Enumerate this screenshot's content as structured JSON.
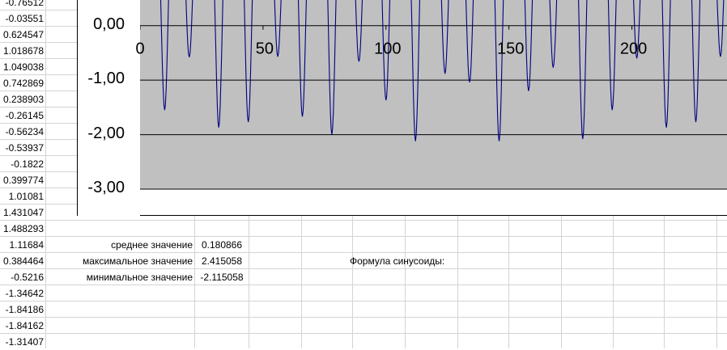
{
  "column_a": [
    "-0.76512",
    "-0.03551",
    "0.624547",
    "1.018678",
    "1.049038",
    "0.742869",
    "0.238903",
    "-0.26145",
    "-0.56234",
    "-0.53937",
    "-0.1822",
    "0.399774",
    "1.01081",
    "1.431047",
    "1.488293",
    "1.11684",
    "0.384464",
    "-0.5216",
    "-1.34642",
    "-1.84186",
    "-1.84162",
    "-1.31407"
  ],
  "stats": {
    "mean_label": "среднее значение",
    "mean_value": "0.180866",
    "max_label": "максимальное значение",
    "max_value": "2.415058",
    "min_label": "минимальное значение",
    "min_value": "-2.115058",
    "formula_label": "Формула синусоиды:"
  },
  "chart_data": {
    "type": "line",
    "x_ticks": [
      "0",
      "50",
      "100",
      "150",
      "200"
    ],
    "y_ticks": [
      "0,00",
      "-1,00",
      "-2,00",
      "-3,00"
    ],
    "y_range": [
      -3,
      0.5
    ],
    "x_range": [
      0,
      239
    ],
    "plot_color": "#C0C0C0",
    "line_color": "#000080",
    "minima": [
      {
        "x": 10,
        "y": -1.55
      },
      {
        "x": 20,
        "y": -0.58
      },
      {
        "x": 32,
        "y": -1.87
      },
      {
        "x": 44,
        "y": -1.77
      },
      {
        "x": 56,
        "y": -0.57
      },
      {
        "x": 66,
        "y": -1.67
      },
      {
        "x": 78,
        "y": -2.0
      },
      {
        "x": 89,
        "y": -0.66
      },
      {
        "x": 100,
        "y": -1.37
      },
      {
        "x": 112,
        "y": -2.12
      },
      {
        "x": 124,
        "y": -0.88
      },
      {
        "x": 134,
        "y": -1.04
      },
      {
        "x": 146,
        "y": -2.12
      },
      {
        "x": 158,
        "y": -1.2
      },
      {
        "x": 168,
        "y": -0.77
      },
      {
        "x": 180,
        "y": -2.08
      },
      {
        "x": 192,
        "y": -1.55
      },
      {
        "x": 202,
        "y": -0.6
      },
      {
        "x": 214,
        "y": -1.87
      },
      {
        "x": 226,
        "y": -1.77
      },
      {
        "x": 236,
        "y": -0.57
      }
    ]
  }
}
